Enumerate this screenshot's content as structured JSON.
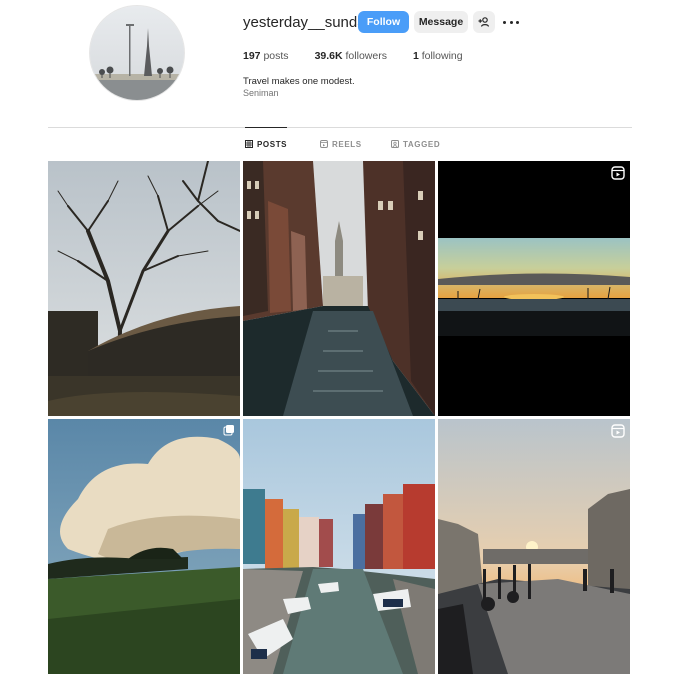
{
  "profile": {
    "username": "yesterday__sunday",
    "follow_label": "Follow",
    "message_label": "Message",
    "posts_count": "197",
    "posts_label": "posts",
    "followers_count": "39.6K",
    "followers_label": "followers",
    "following_count": "1",
    "following_label": "following",
    "bio_line": "Travel makes one modest.",
    "bio_name": "Seniman"
  },
  "tabs": [
    {
      "label": "POSTS",
      "active": true
    },
    {
      "label": "REELS",
      "active": false
    },
    {
      "label": "TAGGED",
      "active": false
    }
  ],
  "posts": [
    {
      "subject": "bare trees and thatched roof",
      "badge": "none"
    },
    {
      "subject": "canal between brick buildings",
      "badge": "none"
    },
    {
      "subject": "sunset over water",
      "badge": "reel-icon"
    },
    {
      "subject": "clouds over green field",
      "badge": "carousel-icon"
    },
    {
      "subject": "colorful houses on canal",
      "badge": "none"
    },
    {
      "subject": "sunset on waterfront promenade",
      "badge": "reel-icon"
    }
  ],
  "colors": {
    "accent": "#4a9df8",
    "button_gray": "#efefef",
    "text": "#262626",
    "muted": "#737373",
    "divider": "#dbdbdb"
  }
}
